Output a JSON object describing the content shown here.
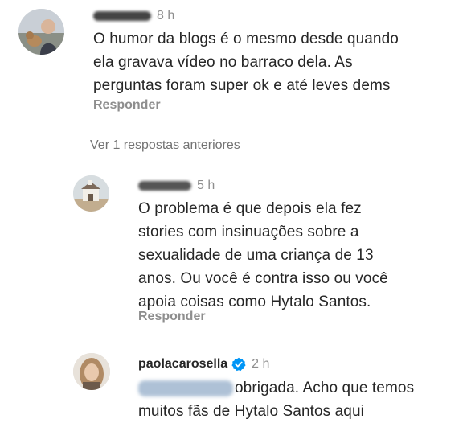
{
  "comments": [
    {
      "time": "8 h",
      "text_lines": [
        "O humor da blogs é o mesmo desde quando",
        "ela gravava vídeo no barraco dela. As",
        "perguntas foram super ok e até leves dems"
      ],
      "reply_label": "Responder"
    },
    {
      "time": "5 h",
      "text_lines": [
        "O problema é que depois ela fez",
        "stories com insinuações sobre a",
        "sexualidade de uma criança de 13",
        "anos. Ou você é contra isso ou você",
        "apoia coisas como Hytalo Santos."
      ],
      "reply_label": "Responder"
    },
    {
      "username": "paolacarosella",
      "time": "2 h",
      "text_line1": "obrigada. Acho que temos",
      "text_line2_partial": "muitos fãs de Hytalo Santos aqui"
    }
  ],
  "view_previous_label": "Ver 1 respostas anteriores",
  "colors": {
    "verified": "#0095f6",
    "muted": "#8e8e8e",
    "text": "#262626"
  }
}
